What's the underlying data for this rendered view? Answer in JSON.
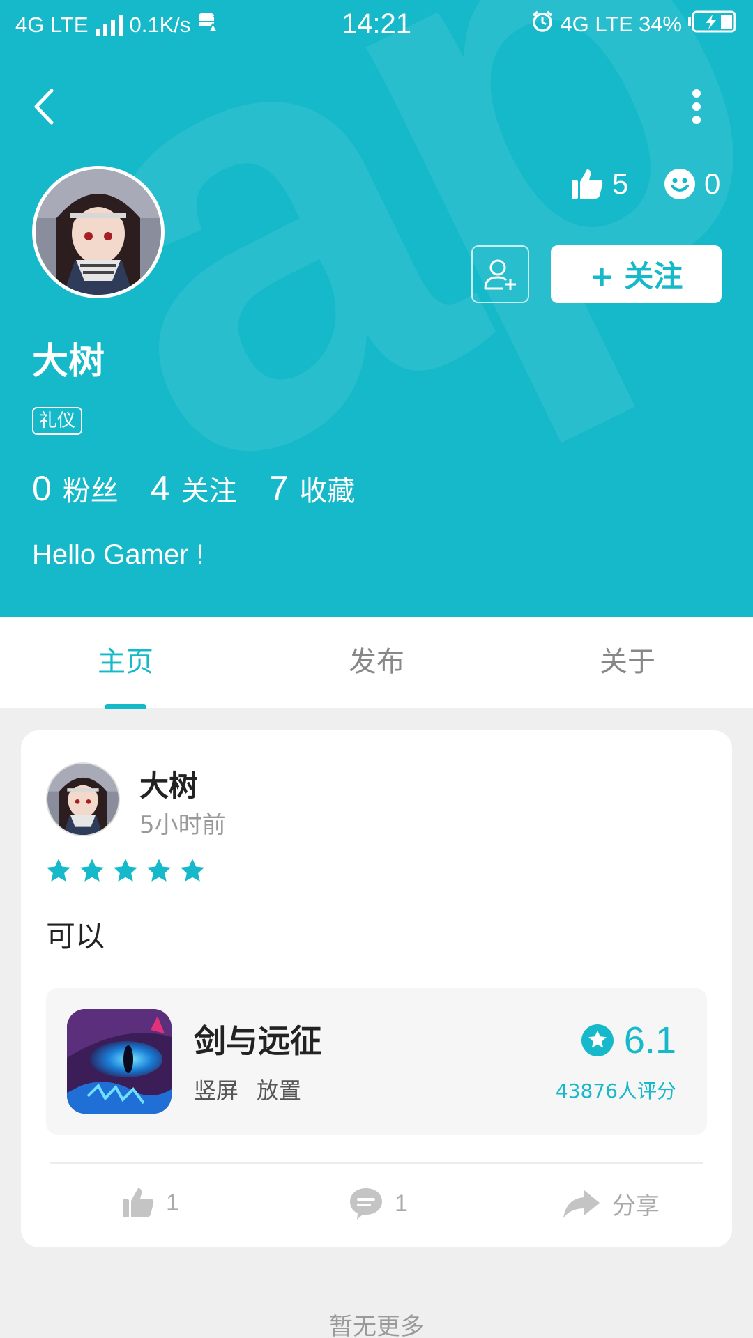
{
  "status_bar": {
    "network": "4G LTE",
    "speed": "0.1K/s",
    "time": "14:21",
    "network_right": "4G LTE",
    "battery": "34%"
  },
  "header": {
    "watermark": "apTap",
    "likes_count": "5",
    "smiles_count": "0",
    "follow_label": "+ 关注",
    "username": "大树",
    "tag": "礼仪",
    "stats": [
      {
        "num": "0",
        "label": "粉丝"
      },
      {
        "num": "4",
        "label": "关注"
      },
      {
        "num": "7",
        "label": "收藏"
      }
    ],
    "bio": "Hello Gamer !"
  },
  "tabs": [
    {
      "label": "主页",
      "active": true
    },
    {
      "label": "发布",
      "active": false
    },
    {
      "label": "关于",
      "active": false
    }
  ],
  "post": {
    "author": "大树",
    "time": "5小时前",
    "stars": 5,
    "text": "可以",
    "game": {
      "name": "剑与远征",
      "tags": [
        "竖屏",
        "放置"
      ],
      "score": "6.1",
      "rating_count": "43876人评分"
    },
    "like_count": "1",
    "comment_count": "1",
    "share_label": "分享"
  },
  "footer": {
    "no_more": "暂无更多"
  },
  "colors": {
    "accent": "#16b9c9",
    "background": "#efefef"
  }
}
